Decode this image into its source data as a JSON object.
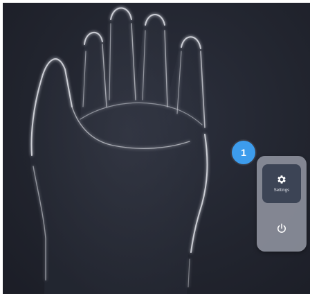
{
  "callout": {
    "number": "1",
    "color": "#3d9cec"
  },
  "menu": {
    "settings": {
      "label": "Settings",
      "icon": "gear-icon"
    },
    "power": {
      "icon": "power-icon"
    }
  },
  "colors": {
    "background": "#22252f",
    "panel": "#989ca8",
    "settings_button": "#3c4455"
  }
}
